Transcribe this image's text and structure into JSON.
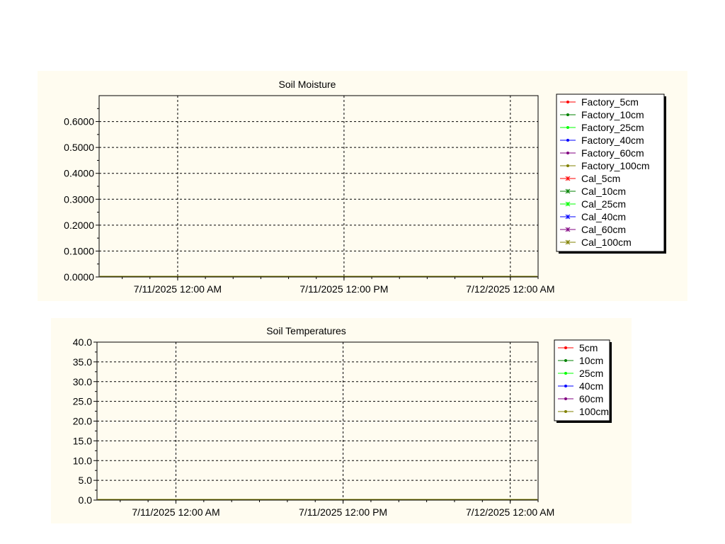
{
  "chart_data": [
    {
      "type": "line",
      "title": "Soil Moisture",
      "xlabel": "",
      "ylabel": "",
      "ylim": [
        0,
        0.7
      ],
      "yticks": [
        "0.0000",
        "0.1000",
        "0.2000",
        "0.3000",
        "0.4000",
        "0.5000",
        "0.6000"
      ],
      "ytick_values": [
        0,
        0.1,
        0.2,
        0.3,
        0.4,
        0.5,
        0.6
      ],
      "xticks": [
        "7/11/2025 12:00 AM",
        "7/11/2025 12:00 PM",
        "7/12/2025 12:00 AM"
      ],
      "xlim": [
        "7/10/2025 6:20 PM",
        "7/12/2025 2:00 AM"
      ],
      "grid": true,
      "legend_position": "right",
      "series": [
        {
          "name": "Factory_5cm",
          "color": "#ff0000",
          "marker": "dot",
          "values": [
            0.0,
            0.0
          ]
        },
        {
          "name": "Factory_10cm",
          "color": "#008000",
          "marker": "dot",
          "values": [
            0.0,
            0.0
          ]
        },
        {
          "name": "Factory_25cm",
          "color": "#00ff00",
          "marker": "dot",
          "values": [
            0.0,
            0.0
          ]
        },
        {
          "name": "Factory_40cm",
          "color": "#0000ff",
          "marker": "dot",
          "values": [
            0.0,
            0.0
          ]
        },
        {
          "name": "Factory_60cm",
          "color": "#800080",
          "marker": "dot",
          "values": [
            0.0,
            0.0
          ]
        },
        {
          "name": "Factory_100cm",
          "color": "#808000",
          "marker": "dot",
          "values": [
            0.0,
            0.0
          ]
        },
        {
          "name": "Cal_5cm",
          "color": "#ff0000",
          "marker": "cross",
          "values": [
            0.0,
            0.0
          ]
        },
        {
          "name": "Cal_10cm",
          "color": "#008000",
          "marker": "cross",
          "values": [
            0.0,
            0.0
          ]
        },
        {
          "name": "Cal_25cm",
          "color": "#00ff00",
          "marker": "cross",
          "values": [
            0.0,
            0.0
          ]
        },
        {
          "name": "Cal_40cm",
          "color": "#0000ff",
          "marker": "cross",
          "values": [
            0.0,
            0.0
          ]
        },
        {
          "name": "Cal_60cm",
          "color": "#800080",
          "marker": "cross",
          "values": [
            0.0,
            0.0
          ]
        },
        {
          "name": "Cal_100cm",
          "color": "#808000",
          "marker": "cross",
          "values": [
            0.0,
            0.0
          ]
        }
      ]
    },
    {
      "type": "line",
      "title": "Soil Temperatures",
      "xlabel": "",
      "ylabel": "",
      "ylim": [
        0,
        40
      ],
      "yticks": [
        "0.0",
        "5.0",
        "10.0",
        "15.0",
        "20.0",
        "25.0",
        "30.0",
        "35.0",
        "40.0"
      ],
      "ytick_values": [
        0,
        5,
        10,
        15,
        20,
        25,
        30,
        35,
        40
      ],
      "xticks": [
        "7/11/2025 12:00 AM",
        "7/11/2025 12:00 PM",
        "7/12/2025 12:00 AM"
      ],
      "xlim": [
        "7/10/2025 6:20 PM",
        "7/12/2025 2:00 AM"
      ],
      "grid": true,
      "legend_position": "right",
      "series": [
        {
          "name": "5cm",
          "color": "#ff0000",
          "marker": "dot",
          "values": [
            0.0,
            0.0
          ]
        },
        {
          "name": "10cm",
          "color": "#008000",
          "marker": "dot",
          "values": [
            0.0,
            0.0
          ]
        },
        {
          "name": "25cm",
          "color": "#00ff00",
          "marker": "dot",
          "values": [
            0.0,
            0.0
          ]
        },
        {
          "name": "40cm",
          "color": "#0000ff",
          "marker": "dot",
          "values": [
            0.0,
            0.0
          ]
        },
        {
          "name": "60cm",
          "color": "#800080",
          "marker": "dot",
          "values": [
            0.0,
            0.0
          ]
        },
        {
          "name": "100cm",
          "color": "#808000",
          "marker": "dot",
          "values": [
            0.0,
            0.0
          ]
        }
      ]
    }
  ]
}
